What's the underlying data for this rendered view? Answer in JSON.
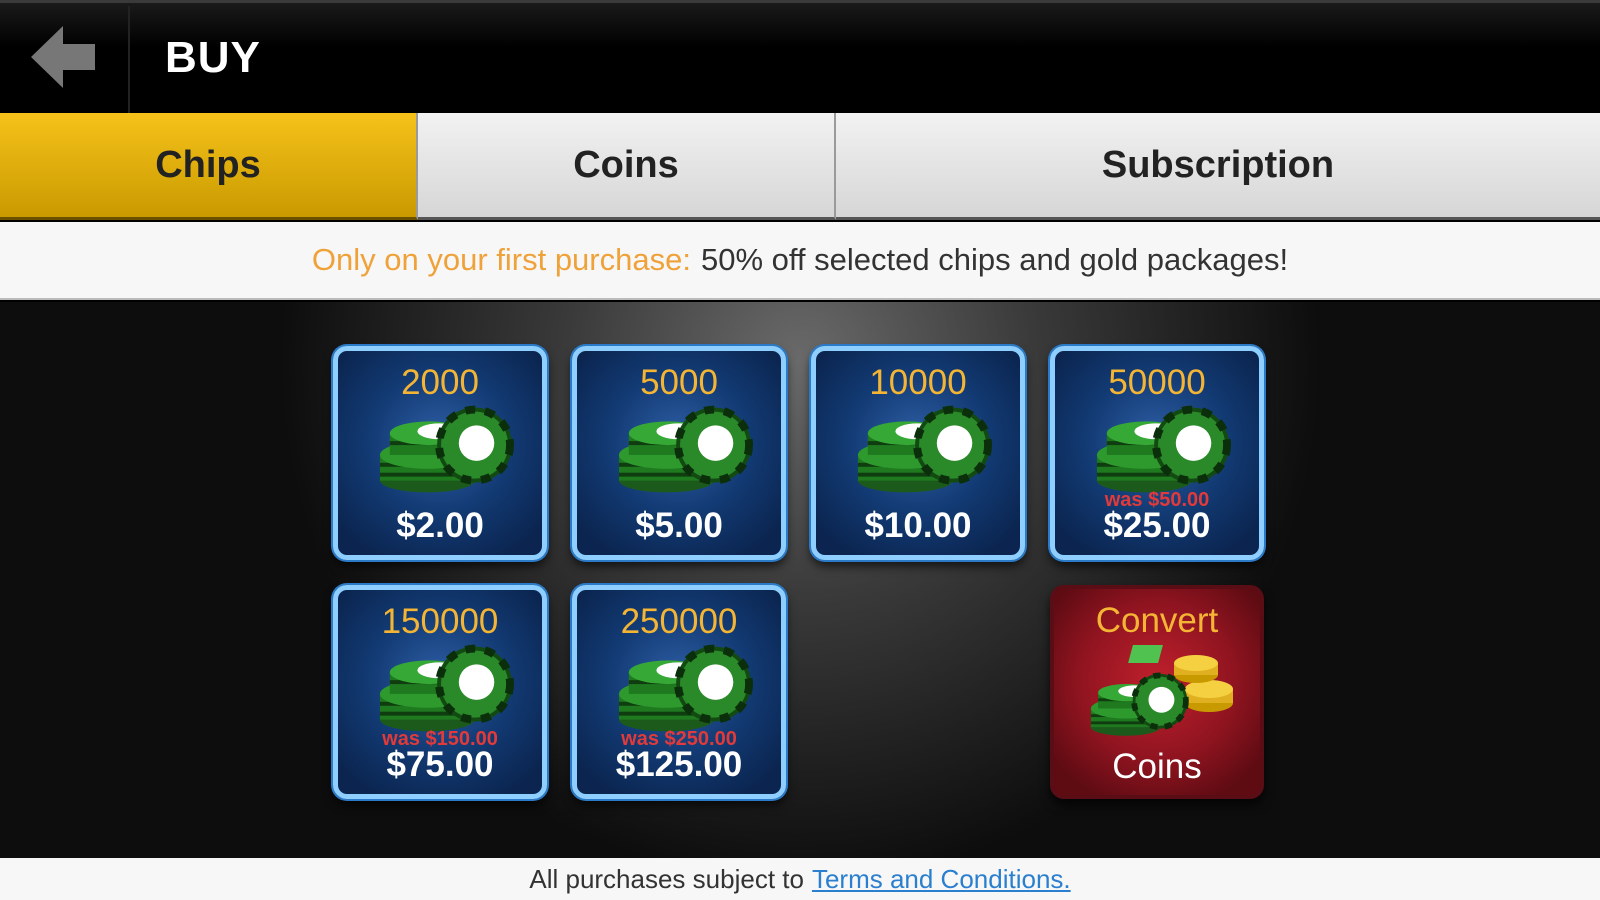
{
  "header": {
    "title": "BUY",
    "back_icon": "back-arrow-icon"
  },
  "tabs": [
    {
      "label": "Chips",
      "active": true
    },
    {
      "label": "Coins",
      "active": false
    },
    {
      "label": "Subscription",
      "active": false
    }
  ],
  "promo": {
    "highlight": "Only on your first purchase:",
    "text": "50% off selected chips and gold packages!"
  },
  "packages": [
    {
      "amount": "2000",
      "price": "$2.00",
      "was": ""
    },
    {
      "amount": "5000",
      "price": "$5.00",
      "was": ""
    },
    {
      "amount": "10000",
      "price": "$10.00",
      "was": ""
    },
    {
      "amount": "50000",
      "price": "$25.00",
      "was": "was $50.00"
    },
    {
      "amount": "150000",
      "price": "$75.00",
      "was": "was $150.00"
    },
    {
      "amount": "250000",
      "price": "$125.00",
      "was": "was $250.00"
    }
  ],
  "convert": {
    "title": "Convert",
    "subtitle": "Coins"
  },
  "footer": {
    "text": "All purchases subject to",
    "link": "Terms and Conditions."
  },
  "colors": {
    "accent_tab": "#f6c21a",
    "promo_highlight": "#f0a23a",
    "tile_border": "#8ecfff",
    "amount_text": "#f5b534",
    "was_text": "#e03a3a",
    "link": "#2a7fcf"
  }
}
